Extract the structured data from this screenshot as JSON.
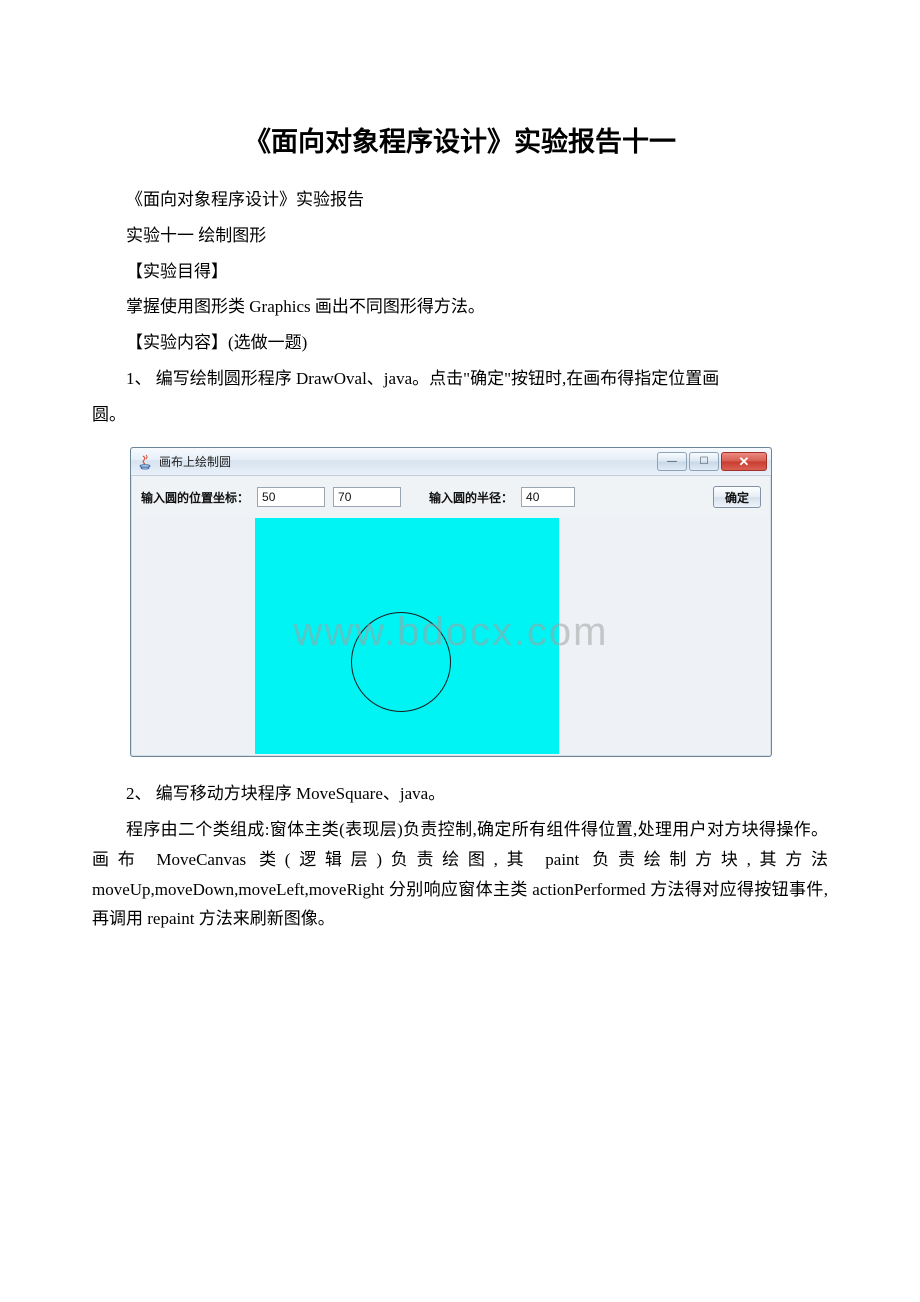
{
  "heading": "《面向对象程序设计》实验报告十一",
  "lines": {
    "l1": "《面向对象程序设计》实验报告",
    "l2": "实验十一 绘制图形",
    "l3": "【实验目得】",
    "l4_pre": "掌握使用图形类 ",
    "l4_en": "Graphics",
    "l4_post": " 画出不同图形得方法。",
    "l5": "【实验内容】(选做一题)",
    "l6_a": "1、 编写绘制圆形程序 ",
    "l6_en": "DrawOval、java",
    "l6_b": "。点击\"确定\"按钮时,在画布得指定位置画",
    "l6_c": "圆。",
    "l7_a": "2、 编写移动方块程序 ",
    "l7_en": "MoveSquare、java",
    "l7_b": "。",
    "l8": "程序由二个类组成:窗体主类(表现层)负责控制,确定所有组件得位置,处理用户对方块得操作。画布 MoveCanvas 类(逻辑层)负责绘图,其 paint 负责绘制方块,其方法moveUp,moveDown,moveLeft,moveRight 分别响应窗体主类 actionPerformed 方法得对应得按钮事件,再调用 repaint 方法来刷新图像。"
  },
  "window": {
    "title": "画布上绘制圆",
    "btn_min": "—",
    "btn_max": "☐",
    "btn_close": "✕",
    "label_pos": "输入圆的位置坐标：",
    "input_x": "50",
    "input_y": "70",
    "label_radius": "输入圆的半径：",
    "input_r": "40",
    "ok": "确定"
  },
  "watermark": "www.bdocx.com"
}
